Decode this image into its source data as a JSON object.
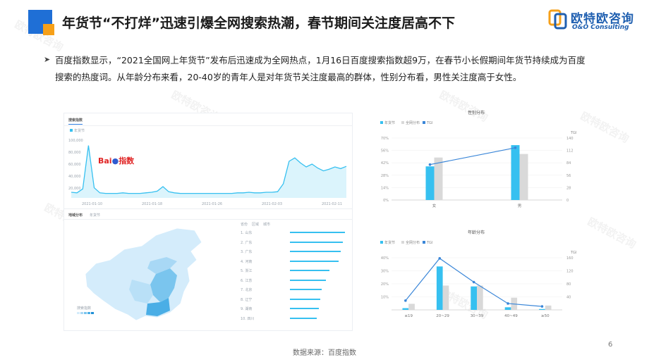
{
  "header": {
    "title": "年货节“不打烊”迅速引爆全网搜索热潮，春节期间关注度居高不下",
    "logo_cn": "欧特欧咨询",
    "logo_en": "O&O Consulting"
  },
  "paragraph": "百度指数显示，“2021全国网上年货节”发布后迅速成为全网热点，1月16日百度搜索指数超9万，在春节小长假期间年货节持续成为百度搜索的热度词。从年龄分布来看，20-40岁的青年人是对年货节关注度最高的群体，性别分布看，男性关注度高于女性。",
  "trend_panel": {
    "tab": "搜索指数",
    "legend": "年货节",
    "logo_text": "Bai",
    "logo_suffix": "指数",
    "y_ticks": [
      "100,000",
      "80,000",
      "60,000",
      "40,000",
      "20,000"
    ],
    "x_ticks": [
      "2021-01-10",
      "2021-01-18",
      "2021-01-26",
      "2021-02-03",
      "2021-02-11"
    ],
    "series_values": [
      10,
      9,
      16,
      93,
      18,
      9,
      8,
      8,
      8,
      9,
      8,
      8,
      8,
      9,
      10,
      12,
      20,
      11,
      9,
      8,
      8,
      8,
      8,
      8,
      8,
      8,
      8,
      8,
      8,
      9,
      9,
      10,
      9,
      9,
      10,
      10,
      11,
      25,
      65,
      71,
      62,
      55,
      60,
      53,
      48,
      51,
      55,
      52,
      56
    ]
  },
  "map_panel": {
    "tab": "地域分布",
    "subtab": "年货节",
    "legend_title": "搜索指数",
    "rank_headers": [
      "省份",
      "区域",
      "城市"
    ],
    "ranks": [
      {
        "name": "1. 山东",
        "value": 100
      },
      {
        "name": "2. 广东",
        "value": 96
      },
      {
        "name": "3. 广东",
        "value": 92
      },
      {
        "name": "4. 河南",
        "value": 88
      },
      {
        "name": "5. 浙江",
        "value": 72
      },
      {
        "name": "6. 江苏",
        "value": 65
      },
      {
        "name": "7. 北京",
        "value": 58
      },
      {
        "name": "8. 辽宁",
        "value": 55
      },
      {
        "name": "9. 湖南",
        "value": 52
      },
      {
        "name": "10. 四川",
        "value": 49
      }
    ]
  },
  "chart_data": [
    {
      "type": "bar",
      "title": "性别分布",
      "categories": [
        "女",
        "男"
      ],
      "legend": [
        "年货节",
        "全网分布",
        "TGI"
      ],
      "series": [
        {
          "name": "年货节",
          "values": [
            38,
            62
          ],
          "color": "#36c0f0"
        },
        {
          "name": "全网分布",
          "values": [
            48,
            52
          ],
          "color": "#d9d9d9"
        },
        {
          "name": "TGI",
          "values": [
            80,
            118
          ],
          "axis": "right",
          "color": "#3a86d8"
        }
      ],
      "y_ticks": [
        "70%",
        "56%",
        "42%",
        "28%",
        "14%",
        "0%"
      ],
      "ylim": [
        0,
        70
      ],
      "y2_ticks": [
        "140",
        "112",
        "84",
        "56",
        "28",
        "0"
      ],
      "y2lim": [
        0,
        140
      ],
      "y2label": "TGI"
    },
    {
      "type": "bar",
      "title": "年龄分布",
      "categories": [
        "≤19",
        "20~29",
        "30~39",
        "40~49",
        "≥50"
      ],
      "legend": [
        "年货节",
        "全网分布",
        "TGI"
      ],
      "series": [
        {
          "name": "年货节",
          "values": [
            2,
            50,
            27,
            3,
            1
          ],
          "color": "#36c0f0"
        },
        {
          "name": "全网分布",
          "values": [
            7,
            28,
            28,
            14,
            5
          ],
          "color": "#d9d9d9"
        },
        {
          "name": "TGI",
          "values": [
            32,
            178,
            96,
            22,
            12
          ],
          "axis": "right",
          "color": "#3a86d8"
        }
      ],
      "y_ticks": [
        "40%",
        "30%",
        "20%",
        "10%"
      ],
      "ylim": [
        0,
        60
      ],
      "y2_ticks": [
        "160",
        "120",
        "80",
        "40"
      ],
      "y2lim": [
        0,
        180
      ],
      "y2label": "TGI"
    }
  ],
  "footer": {
    "source": "数据来源：百度指数",
    "page_number": "6"
  }
}
